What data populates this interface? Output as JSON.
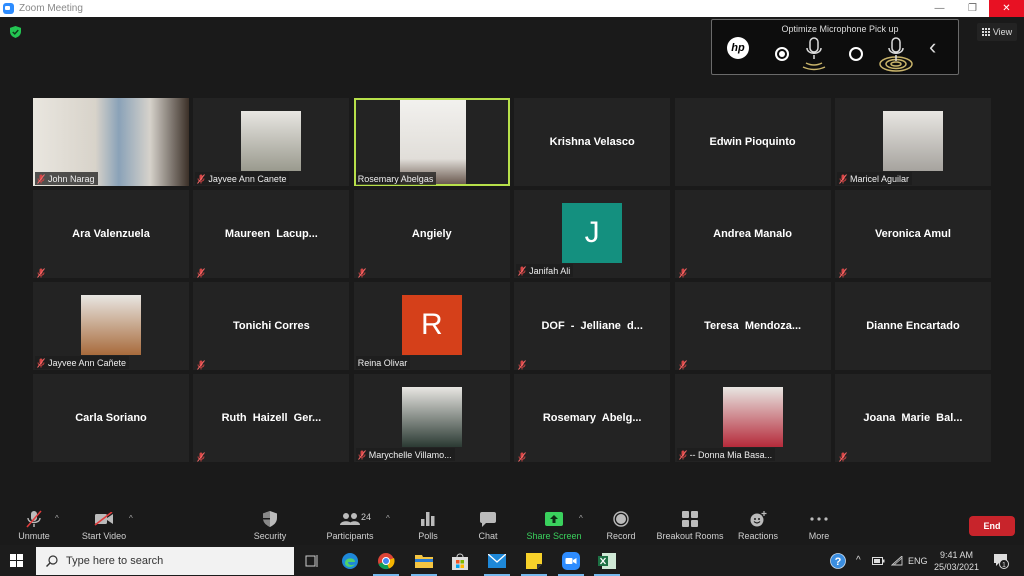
{
  "window": {
    "title": "Zoom Meeting",
    "controls": {
      "minimize": "—",
      "restore": "❐",
      "close": "✕"
    }
  },
  "meeting": {
    "security_badge": "encrypted-shield",
    "hp_panel": {
      "title": "Optimize Microphone Pick up",
      "logo": "hp",
      "options": [
        {
          "name": "personal-mic",
          "selected": true
        },
        {
          "name": "conference-mic",
          "selected": false
        }
      ],
      "collapse_icon": "‹"
    },
    "view_button": {
      "label": "View"
    },
    "participants": [
      {
        "name": "John Narag",
        "type": "video",
        "muted": true,
        "color": "#d9d4cc"
      },
      {
        "name": "Jayvee Ann Canete",
        "type": "photo",
        "muted": true,
        "color": "#9a9a8e"
      },
      {
        "name": "Rosemary Abelgas",
        "type": "video",
        "muted": false,
        "active_speaker": true,
        "color": "#e8e6e2"
      },
      {
        "name": "Krishna Velasco",
        "type": "name",
        "muted": false
      },
      {
        "name": "Edwin Pioquinto",
        "type": "name",
        "muted": false
      },
      {
        "name": "Maricel Aguilar",
        "type": "photo",
        "muted": true,
        "color": "#a6a39e"
      },
      {
        "name": "Ara Valenzuela",
        "type": "name",
        "muted": true
      },
      {
        "name": "Maureen  Lacup...",
        "type": "name",
        "muted": true
      },
      {
        "name": "Angiely",
        "type": "name",
        "muted": true
      },
      {
        "name": "Janifah Ali",
        "type": "letter",
        "letter": "J",
        "muted": true,
        "color": "#14907f"
      },
      {
        "name": "Andrea Manalo",
        "type": "name",
        "muted": true
      },
      {
        "name": "Veronica Amul",
        "type": "name",
        "muted": true
      },
      {
        "name": "Jayvee Ann Cañete",
        "type": "photo",
        "muted": true,
        "color": "#a86b3c"
      },
      {
        "name": "Tonichi Corres",
        "type": "name",
        "muted": true
      },
      {
        "name": "Reina Olivar",
        "type": "letter",
        "letter": "R",
        "muted": false,
        "color": "#d5401a"
      },
      {
        "name": "DOF  -  Jelliane  d...",
        "type": "name",
        "muted": true
      },
      {
        "name": "Teresa  Mendoza...",
        "type": "name",
        "muted": true
      },
      {
        "name": "Dianne Encartado",
        "type": "name",
        "muted": false
      },
      {
        "name": "Carla Soriano",
        "type": "name",
        "muted": false
      },
      {
        "name": "Ruth  Haizell  Ger...",
        "type": "name",
        "muted": true
      },
      {
        "name": "Marychelle Villamo...",
        "type": "photo",
        "muted": true,
        "color": "#2b3a33"
      },
      {
        "name": "Rosemary  Abelg...",
        "type": "name",
        "muted": true
      },
      {
        "name": "-- Donna Mia Basa...",
        "type": "photo",
        "muted": true,
        "color": "#b52a3a"
      },
      {
        "name": "Joana  Marie  Bal...",
        "type": "name",
        "muted": true
      }
    ]
  },
  "toolbar": {
    "unmute": "Unmute",
    "start_video": "Start Video",
    "security": "Security",
    "participants": "Participants",
    "participant_count": "24",
    "polls": "Polls",
    "chat": "Chat",
    "share_screen": "Share Screen",
    "record": "Record",
    "breakout_rooms": "Breakout Rooms",
    "reactions": "Reactions",
    "more": "More",
    "end": "End",
    "accent_green": "#3ad15d",
    "end_color": "#c8242b"
  },
  "taskbar": {
    "search_placeholder": "Type here to search",
    "apps": [
      "task-view",
      "edge",
      "chrome",
      "file-explorer",
      "store",
      "mail",
      "sticky-notes",
      "zoom",
      "excel"
    ],
    "language": "ENG",
    "time": "9:41 AM",
    "date": "25/03/2021",
    "notification_count": "1"
  }
}
